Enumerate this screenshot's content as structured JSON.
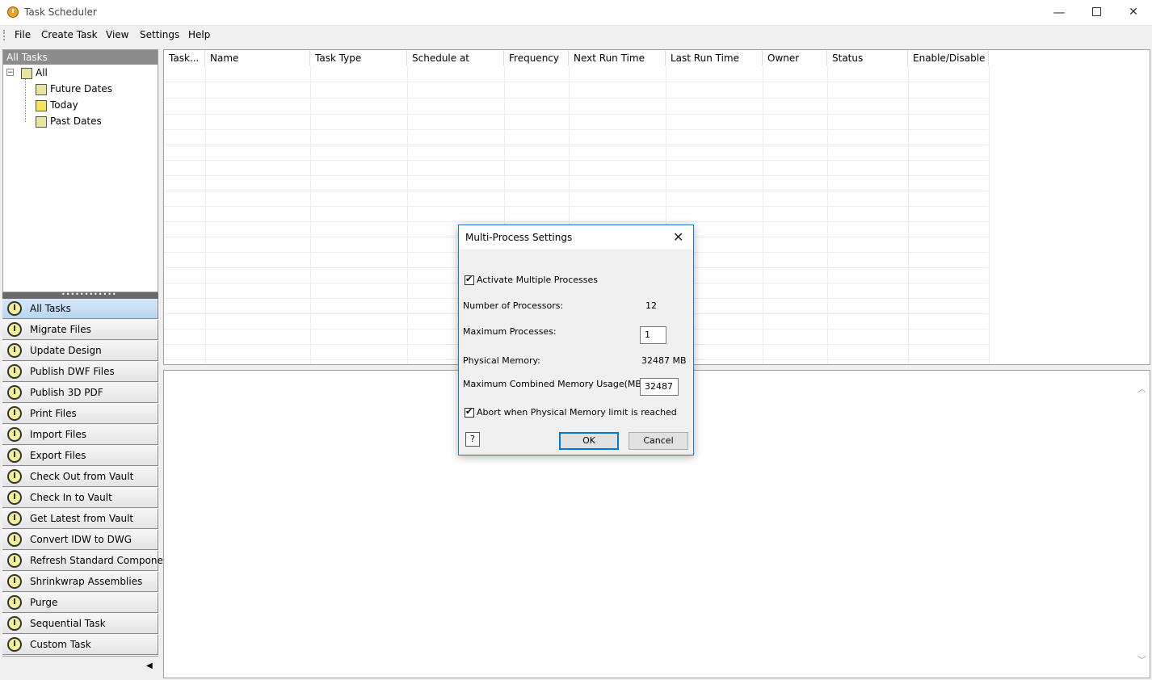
{
  "window": {
    "title": "Task Scheduler",
    "minimize_label": "—",
    "close_label": "✕"
  },
  "menu": {
    "file": "File",
    "create_task": "Create Task",
    "view": "View",
    "settings": "Settings",
    "help": "Help"
  },
  "left_panel": {
    "header": "All Tasks",
    "tree": {
      "root": "All",
      "children": [
        "Future Dates",
        "Today",
        "Past Dates"
      ]
    },
    "task_buttons": [
      "All Tasks",
      "Migrate Files",
      "Update Design",
      "Publish DWF Files",
      "Publish 3D PDF",
      "Print Files",
      "Import Files",
      "Export Files",
      "Check Out from Vault",
      "Check In to Vault",
      "Get Latest from Vault",
      "Convert IDW to DWG",
      "Refresh Standard Components",
      "Shrinkwrap Assemblies",
      "Purge",
      "Sequential Task",
      "Custom Task"
    ],
    "active_task": "All Tasks"
  },
  "grid": {
    "columns": [
      "Task...",
      "Name",
      "Task Type",
      "Schedule at",
      "Frequency",
      "Next Run Time",
      "Last Run Time",
      "Owner",
      "Status",
      "Enable/Disable"
    ]
  },
  "dialog": {
    "title": "Multi-Process Settings",
    "activate_label": "Activate Multiple Processes",
    "activate_checked": true,
    "num_processors_label": "Number of Processors:",
    "num_processors_value": "12",
    "max_processes_label": "Maximum Processes:",
    "max_processes_value": "1",
    "physical_memory_label": "Physical Memory:",
    "physical_memory_value": "32487 MB",
    "max_memory_label": "Maximum Combined Memory Usage(MB):",
    "max_memory_value": "32487",
    "abort_label": "Abort when Physical Memory limit is reached",
    "abort_checked": true,
    "ok_label": "OK",
    "cancel_label": "Cancel",
    "help_label": "?"
  },
  "colors": {
    "accent": "#1e78d2",
    "active_task_bg": "#b9d5f1",
    "panel_header_bg": "#8c8c8c"
  }
}
